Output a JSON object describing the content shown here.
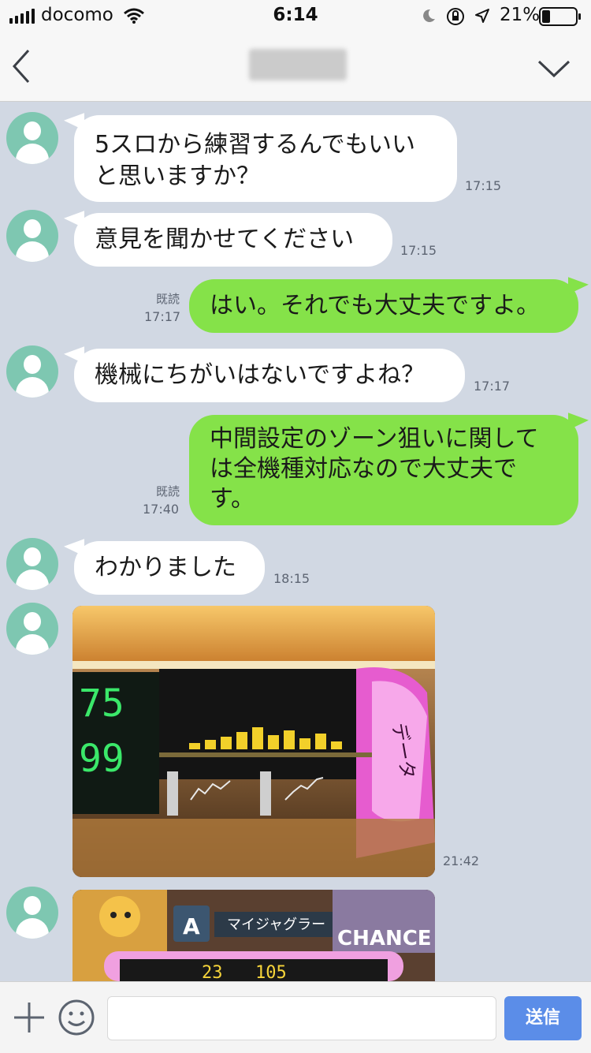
{
  "status_bar": {
    "carrier": "docomo",
    "time": "6:14",
    "battery": "21%"
  },
  "header": {
    "back_label": "",
    "menu_label": ""
  },
  "messages": [
    {
      "text": "5スロから練習するんでもいいと思いますか？",
      "time": "17:15"
    },
    {
      "text": "意見を聞かせてください",
      "time": "17:15"
    },
    {
      "text": "はい。それでも大丈夫ですよ。",
      "time": "17:17",
      "read": "既読"
    },
    {
      "text": "機械にちがいはないですよね？",
      "time": "17:17"
    },
    {
      "text": "中間設定のゾーン狙いに関しては全機種対応なので大丈夫です。",
      "time": "17:40",
      "read": "既読"
    },
    {
      "text": "わかりました",
      "time": "18:15"
    },
    {
      "time": "21:42",
      "photo_label": "データ",
      "counter_1": "75",
      "counter_2": "99"
    },
    {
      "photo_label": "マイジャグラー",
      "badge": "A",
      "logo": "CHANCE",
      "counter_1": "23",
      "counter_2": "105"
    }
  ],
  "composer": {
    "placeholder": "",
    "send_label": "送信"
  },
  "colors": {
    "background": "#d1d8e3",
    "outgoing_bubble": "#85e249",
    "incoming_bubble": "#ffffff",
    "avatar": "#7ec7b1",
    "send_button": "#5b8de8"
  },
  "icons": [
    "wifi-icon",
    "moon-icon",
    "orientation-lock-icon",
    "location-icon",
    "battery-icon",
    "back-chevron-icon",
    "menu-chevron-icon",
    "plus-icon",
    "emoji-icon",
    "avatar-icon"
  ]
}
